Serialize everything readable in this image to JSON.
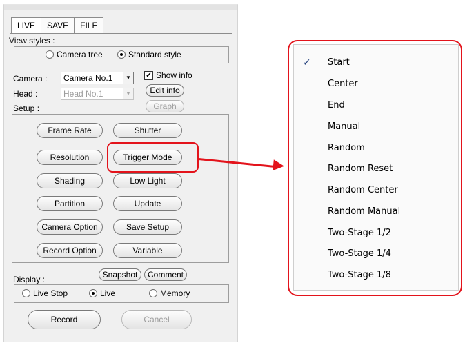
{
  "panel": {
    "tabs": [
      {
        "label": "LIVE"
      },
      {
        "label": "SAVE"
      },
      {
        "label": "FILE"
      }
    ],
    "view_styles": {
      "label": "View styles :",
      "options": [
        {
          "label": "Camera tree",
          "selected": false
        },
        {
          "label": "Standard style",
          "selected": true
        }
      ]
    },
    "camera": {
      "label": "Camera :",
      "value": "Camera No.1",
      "show_info_label": "Show info",
      "show_info_checked": true,
      "edit_info_label": "Edit info"
    },
    "head": {
      "label": "Head :",
      "value": "Head No.1",
      "graph_label": "Graph"
    },
    "setup": {
      "label": "Setup :",
      "buttons": [
        {
          "label": "Frame Rate"
        },
        {
          "label": "Shutter"
        },
        {
          "label": "Resolution"
        },
        {
          "label": "Trigger Mode"
        },
        {
          "label": "Shading"
        },
        {
          "label": "Low Light"
        },
        {
          "label": "Partition"
        },
        {
          "label": "Update"
        },
        {
          "label": "Camera Option"
        },
        {
          "label": "Save Setup"
        },
        {
          "label": "Record Option"
        },
        {
          "label": "Variable"
        }
      ]
    },
    "display": {
      "label": "Display :",
      "snapshot_label": "Snapshot",
      "comment_label": "Comment",
      "options": [
        {
          "label": "Live Stop",
          "selected": false
        },
        {
          "label": "Live",
          "selected": true
        },
        {
          "label": "Memory",
          "selected": false
        }
      ]
    },
    "record_label": "Record",
    "cancel_label": "Cancel"
  },
  "trigger_menu": {
    "items": [
      {
        "label": "Start",
        "checked": true
      },
      {
        "label": "Center",
        "checked": false
      },
      {
        "label": "End",
        "checked": false
      },
      {
        "label": "Manual",
        "checked": false
      },
      {
        "label": "Random",
        "checked": false
      },
      {
        "label": "Random Reset",
        "checked": false
      },
      {
        "label": "Random Center",
        "checked": false
      },
      {
        "label": "Random Manual",
        "checked": false
      },
      {
        "label": "Two-Stage 1/2",
        "checked": false
      },
      {
        "label": "Two-Stage 1/4",
        "checked": false
      },
      {
        "label": "Two-Stage 1/8",
        "checked": false
      }
    ],
    "check_glyph": "✓"
  },
  "colors": {
    "highlight": "#e3131b",
    "check": "#1f3d7a"
  }
}
